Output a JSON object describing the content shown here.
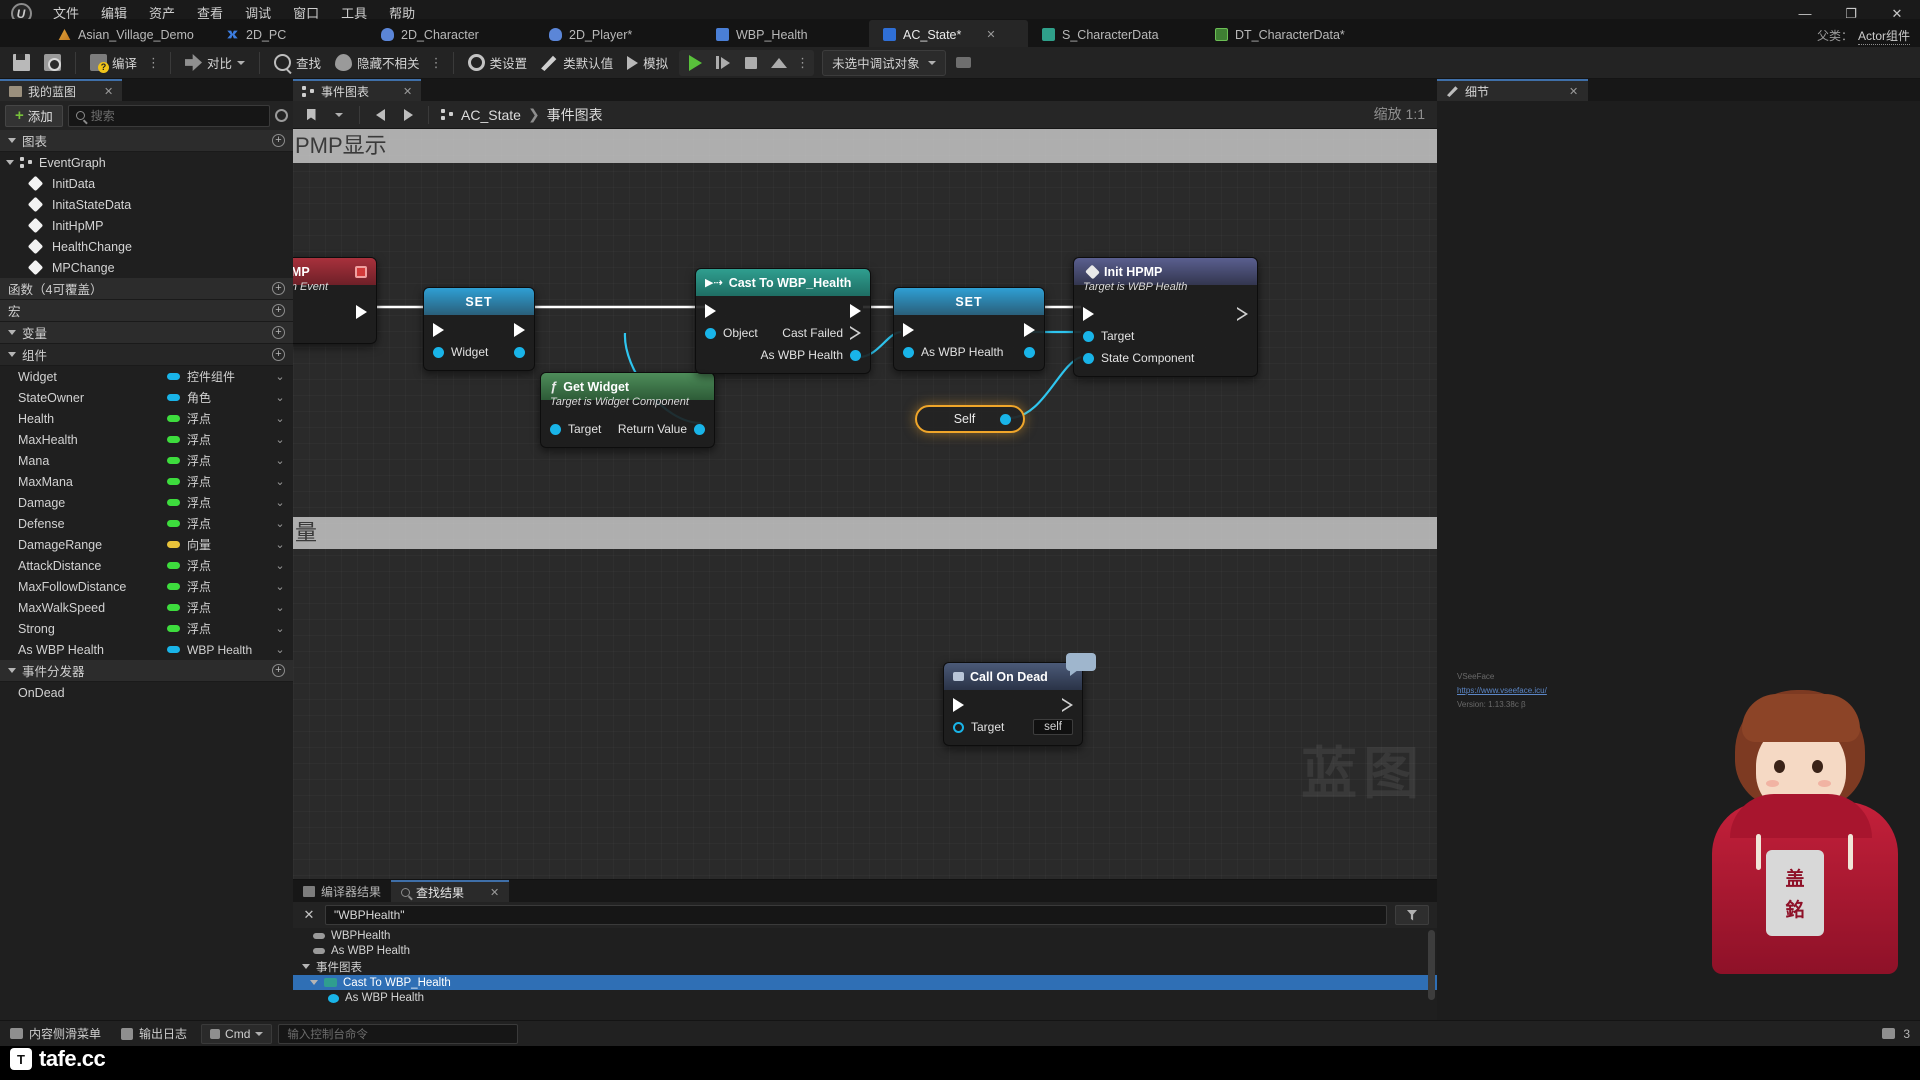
{
  "app": {
    "logo": "ue-logo",
    "menu": [
      "文件",
      "编辑",
      "资产",
      "查看",
      "调试",
      "窗口",
      "工具",
      "帮助"
    ],
    "window_controls": {
      "minimize": "—",
      "maximize": "❐",
      "close": "✕"
    }
  },
  "asset_tabs": [
    {
      "label": "Asian_Village_Demo",
      "icon": "village-icon",
      "active": false,
      "dirty": false
    },
    {
      "label": "2D_PC",
      "icon": "blueprint-icon",
      "active": false,
      "dirty": false
    },
    {
      "label": "2D_Character",
      "icon": "character-icon",
      "active": false,
      "dirty": false
    },
    {
      "label": "2D_Player*",
      "icon": "character-icon",
      "active": false,
      "dirty": true
    },
    {
      "label": "WBP_Health",
      "icon": "widget-icon",
      "active": false,
      "dirty": false
    },
    {
      "label": "AC_State*",
      "icon": "actor-component-icon",
      "active": true,
      "dirty": true
    },
    {
      "label": "S_CharacterData",
      "icon": "struct-icon",
      "active": false,
      "dirty": false
    },
    {
      "label": "DT_CharacterData*",
      "icon": "datatable-icon",
      "active": false,
      "dirty": true
    }
  ],
  "parent_class": {
    "label": "父类：",
    "value": "Actor组件"
  },
  "toolbar": {
    "save_label": "",
    "browse_label": "",
    "compile_label": "编译",
    "diff_label": "对比",
    "find_label": "查找",
    "hide_unrelated_label": "隐藏不相关",
    "class_settings_label": "类设置",
    "class_defaults_label": "类默认值",
    "simulate_label": "模拟",
    "debug_object": "未选中调试对象",
    "overflow": "⋮"
  },
  "my_blueprint": {
    "tab_label": "我的蓝图",
    "add_label": "添加",
    "search_placeholder": "搜索",
    "sections": {
      "graphs": "图表",
      "functions": "函数（4可覆盖）",
      "macros": "宏",
      "variables": "变量",
      "components": "组件",
      "event_dispatchers": "事件分发器"
    },
    "event_graph": "EventGraph",
    "graph_functions": [
      "InitData",
      "InitaStateData",
      "InitHpMP",
      "HealthChange",
      "MPChange"
    ],
    "variables": [
      {
        "name": "Widget",
        "type": "控件组件",
        "color": "#19b4e8"
      },
      {
        "name": "StateOwner",
        "type": "角色",
        "color": "#19b4e8"
      },
      {
        "name": "Health",
        "type": "浮点",
        "color": "#3ddc3d"
      },
      {
        "name": "MaxHealth",
        "type": "浮点",
        "color": "#3ddc3d"
      },
      {
        "name": "Mana",
        "type": "浮点",
        "color": "#3ddc3d"
      },
      {
        "name": "MaxMana",
        "type": "浮点",
        "color": "#3ddc3d"
      },
      {
        "name": "Damage",
        "type": "浮点",
        "color": "#3ddc3d"
      },
      {
        "name": "Defense",
        "type": "浮点",
        "color": "#3ddc3d"
      },
      {
        "name": "DamageRange",
        "type": "向量",
        "color": "#e8c23a"
      },
      {
        "name": "AttackDistance",
        "type": "浮点",
        "color": "#3ddc3d"
      },
      {
        "name": "MaxFollowDistance",
        "type": "浮点",
        "color": "#3ddc3d"
      },
      {
        "name": "MaxWalkSpeed",
        "type": "浮点",
        "color": "#3ddc3d"
      },
      {
        "name": "Strong",
        "type": "浮点",
        "color": "#3ddc3d"
      },
      {
        "name": "As WBP Health",
        "type": "WBP Health",
        "color": "#19b4e8"
      }
    ],
    "dispatchers": [
      "OnDead"
    ]
  },
  "graph": {
    "tab_label": "事件图表",
    "breadcrumb_asset": "AC_State",
    "breadcrumb_graph": "事件图表",
    "zoom_label": "缩放 1:1",
    "comment_top": "PMP显示",
    "comment_bottom": "量",
    "watermark": "蓝图",
    "nodes": [
      {
        "name": "init-hpmp-event",
        "title": "nitHpMP",
        "subtitle": "Custom Event",
        "kind": "event",
        "pins_out": []
      },
      {
        "name": "set-widget-1",
        "title": "SET",
        "kind": "set",
        "pin_label": "Widget"
      },
      {
        "name": "get-widget",
        "title": "Get Widget",
        "subtitle": "Target is Widget Component",
        "kind": "function",
        "in_label": "Target",
        "out_label": "Return Value"
      },
      {
        "name": "cast-to-wbp-health",
        "title": "Cast To WBP_Health",
        "kind": "cast",
        "in_object": "Object",
        "out_cast_failed": "Cast Failed",
        "out_as_wbp": "As WBP Health"
      },
      {
        "name": "set-as-wbp-health",
        "title": "SET",
        "kind": "set",
        "pin_label": "As WBP Health"
      },
      {
        "name": "init-hpmp-call",
        "title": "Init HPMP",
        "subtitle": "Target is WBP Health",
        "kind": "event2",
        "in_target": "Target",
        "in_state_component": "State Component"
      },
      {
        "name": "self-node",
        "title": "Self",
        "kind": "variable-selected"
      },
      {
        "name": "call-on-dead",
        "title": "Call On Dead",
        "kind": "dispatcher",
        "in_target": "Target",
        "target_value": "self"
      }
    ]
  },
  "bottom_panel": {
    "tabs": [
      {
        "label": "编译器结果",
        "active": false
      },
      {
        "label": "查找结果",
        "active": true
      }
    ],
    "find_query": "\"WBPHealth\"",
    "results": [
      {
        "label": "WBPHealth",
        "indent": 1,
        "icon": "property-icon",
        "highlight": false
      },
      {
        "label": "As WBP Health",
        "indent": 1,
        "icon": "property-icon",
        "highlight": false
      },
      {
        "label": "事件图表",
        "indent": 0,
        "icon": "expander-icon",
        "highlight": false
      },
      {
        "label": "Cast To WBP_Health",
        "indent": 1,
        "icon": "cast-icon",
        "highlight": true
      },
      {
        "label": "As WBP Health",
        "indent": 2,
        "icon": "pin-icon",
        "highlight": false
      }
    ]
  },
  "details": {
    "tab_label": "细节",
    "credit_name": "VSeeFace",
    "credit_url": "https://www.vseeface.icu/",
    "credit_version": "Version: 1.13.38c β"
  },
  "status_bar": {
    "content_drawer": "内容侧滑菜单",
    "output_log": "输出日志",
    "cmd_label": "Cmd",
    "cmd_placeholder": "输入控制台命令",
    "right_label": "3"
  },
  "watermark": {
    "text": "tafe.cc",
    "icon": "tafe-logo"
  },
  "colors": {
    "accent_blue": "#3f6fa8",
    "exec_white": "#ffffff",
    "object_blue": "#19b4e8",
    "float_green": "#3ddc3d",
    "vector_yellow": "#e8c23a",
    "cast_teal": "#2f9e8f",
    "event_red": "#a8313c",
    "selection_orange": "#f0a62a",
    "play_green": "#59c13b"
  }
}
